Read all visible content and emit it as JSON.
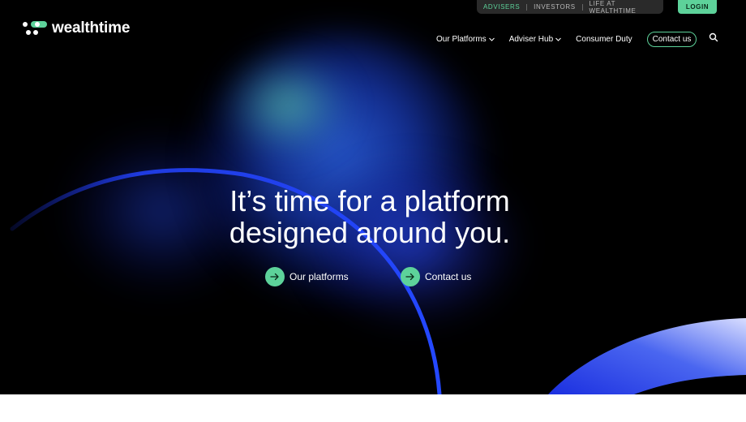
{
  "colors": {
    "accent": "#5dd29a",
    "hero_background": "#000000",
    "arc_blue": "#1f3be0"
  },
  "topbar": {
    "links": [
      {
        "label": "ADVISERS"
      },
      {
        "label": "INVESTORS"
      },
      {
        "label": "LIFE AT WEALTHTIME"
      }
    ],
    "login_label": "LOGIN"
  },
  "logo": {
    "text": "wealthtime"
  },
  "nav": {
    "items": [
      {
        "label": "Our Platforms",
        "icon": "chevron-down-icon"
      },
      {
        "label": "Adviser Hub",
        "icon": "chevron-down-icon"
      },
      {
        "label": "Consumer Duty"
      }
    ],
    "contact_label": "Contact us",
    "search_icon": "search-icon"
  },
  "hero": {
    "headline_line1": "It’s time for a platform",
    "headline_line2": "designed around you.",
    "ctas": [
      {
        "label": "Our platforms",
        "icon": "arrow-right-icon"
      },
      {
        "label": "Contact us",
        "icon": "arrow-right-icon"
      }
    ]
  }
}
